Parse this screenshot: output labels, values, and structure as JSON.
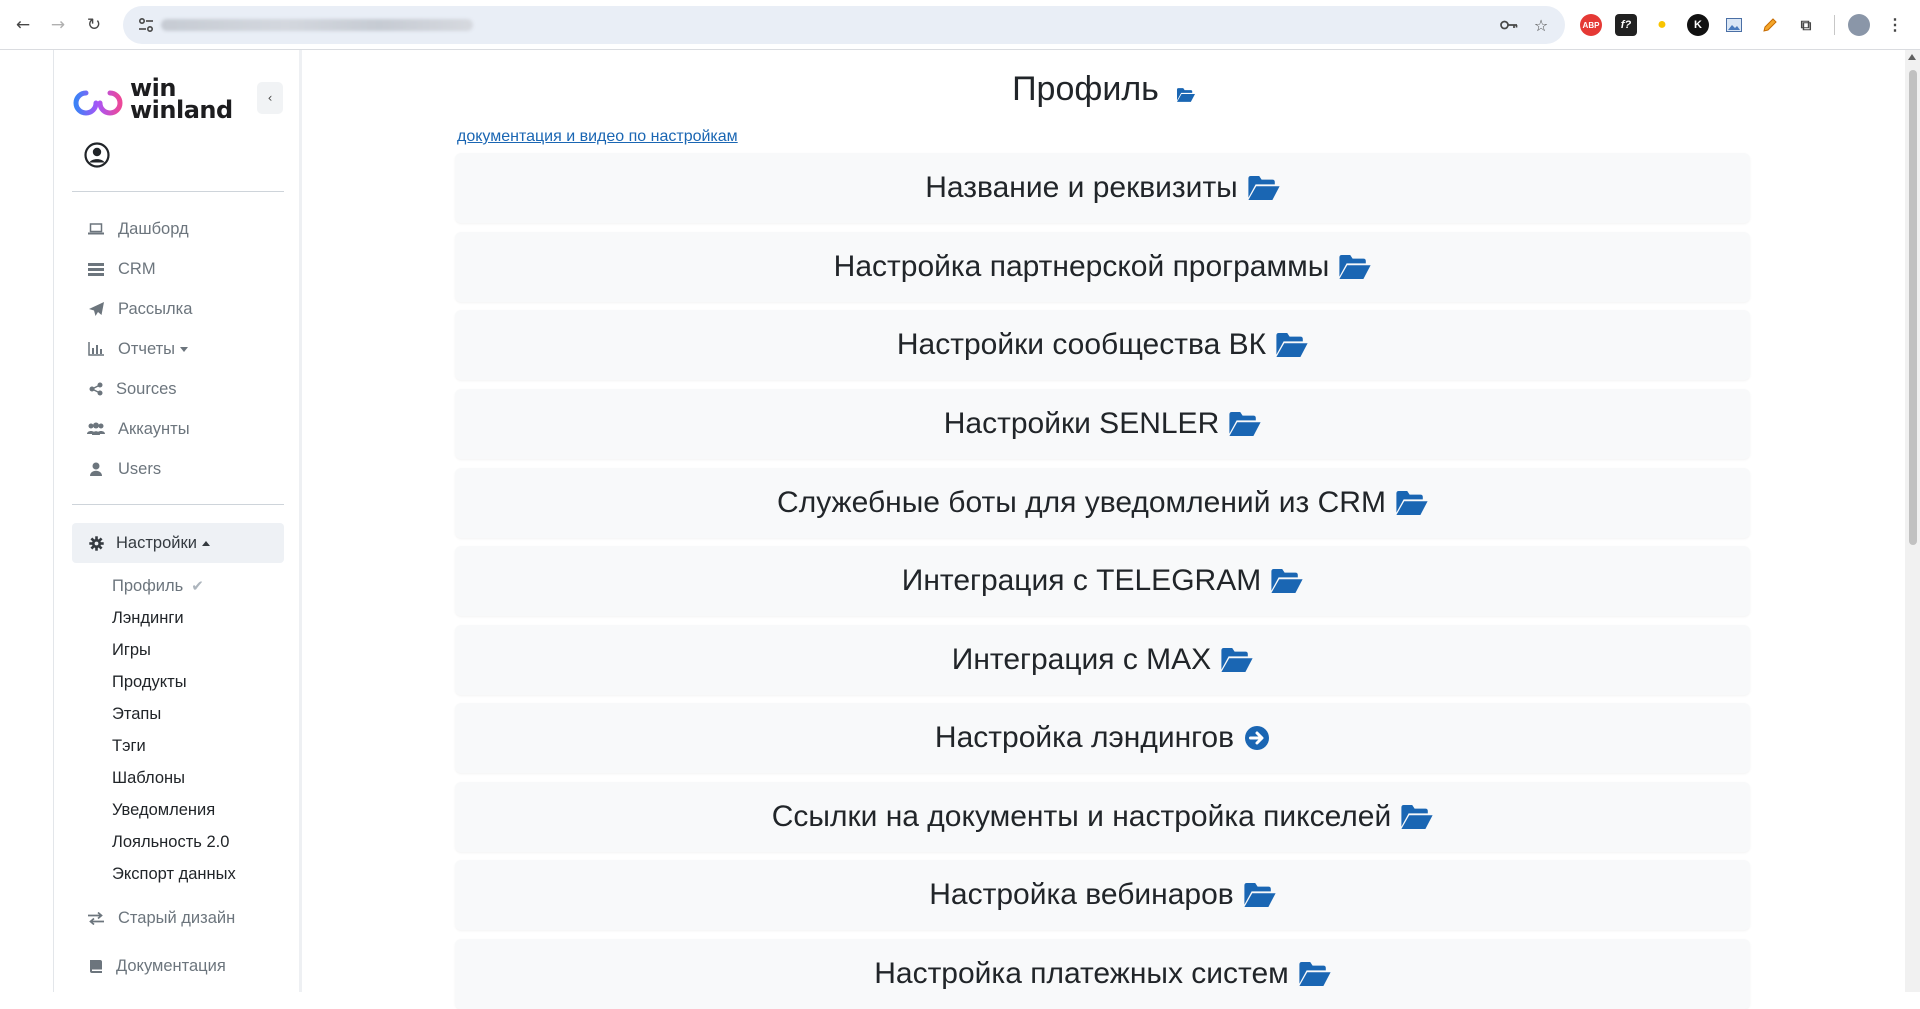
{
  "browser": {
    "extensions": [
      "ABP",
      "f?",
      "bulb",
      "K",
      "img",
      "pencil",
      "puzzle"
    ]
  },
  "sidebar": {
    "logo_line1": "win",
    "logo_line2": "winland",
    "main_items": [
      {
        "label": "Дашборд",
        "icon": "laptop-icon"
      },
      {
        "label": "CRM",
        "icon": "list-icon"
      },
      {
        "label": "Рассылка",
        "icon": "send-icon"
      },
      {
        "label": "Отчеты",
        "icon": "chart-icon",
        "dropdown": true
      },
      {
        "label": "Sources",
        "icon": "share-icon"
      },
      {
        "label": "Аккаунты",
        "icon": "users-icon"
      },
      {
        "label": "Users",
        "icon": "user-icon"
      }
    ],
    "settings_label": "Настройки",
    "sub_items": [
      {
        "label": "Профиль",
        "current": true
      },
      {
        "label": "Лэндинги"
      },
      {
        "label": "Игры"
      },
      {
        "label": "Продукты"
      },
      {
        "label": "Этапы"
      },
      {
        "label": "Тэги"
      },
      {
        "label": "Шаблоны"
      },
      {
        "label": "Уведомления"
      },
      {
        "label": "Лояльность 2.0"
      },
      {
        "label": "Экспорт данных"
      }
    ],
    "old_design_label": "Старый дизайн",
    "docs_label": "Документация"
  },
  "main": {
    "title": "Профиль",
    "doc_link": "документация и видео по настройкам",
    "sections": [
      {
        "label": "Название и реквизиты",
        "icon": "folder-open-icon"
      },
      {
        "label": "Настройка партнерской программы",
        "icon": "folder-open-icon"
      },
      {
        "label": "Настройки сообщества ВК",
        "icon": "folder-open-icon"
      },
      {
        "label": "Настройки SENLER",
        "icon": "folder-open-icon"
      },
      {
        "label": "Служебные боты для уведомлений из CRM",
        "icon": "folder-open-icon"
      },
      {
        "label": "Интеграция с TELEGRAM",
        "icon": "folder-open-icon"
      },
      {
        "label": "Интеграция с MAX",
        "icon": "folder-open-icon"
      },
      {
        "label": "Настройка лэндингов",
        "icon": "arrow-circle-right-icon"
      },
      {
        "label": "Ссылки на документы и настройка пикселей",
        "icon": "folder-open-icon"
      },
      {
        "label": "Настройка вебинаров",
        "icon": "folder-open-icon"
      },
      {
        "label": "Настройка платежных систем",
        "icon": "folder-open-icon"
      }
    ]
  },
  "colors": {
    "accent_blue": "#1a66b3",
    "active_bg": "#eef1f5",
    "section_bg": "#f8f9fa"
  }
}
